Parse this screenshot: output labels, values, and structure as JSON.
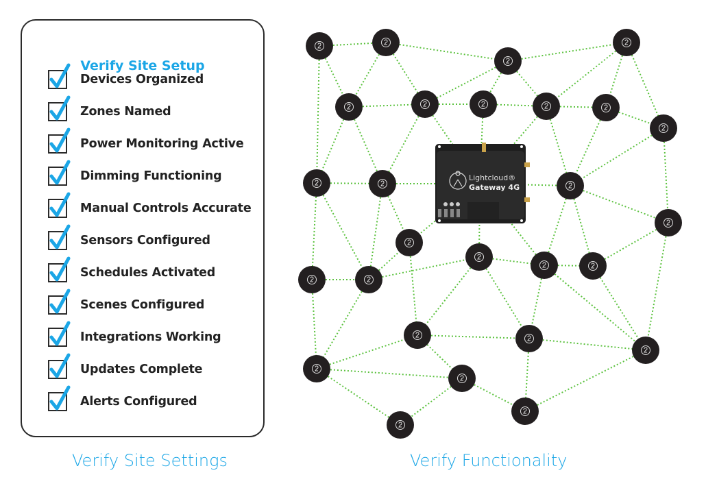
{
  "checklist": {
    "title": "Verify Site Setup",
    "items": [
      {
        "label": "Devices Organized",
        "checked": true
      },
      {
        "label": "Zones Named",
        "checked": true
      },
      {
        "label": "Power Monitoring Active",
        "checked": true
      },
      {
        "label": "Dimming Functioning",
        "checked": true
      },
      {
        "label": "Manual Controls Accurate",
        "checked": true
      },
      {
        "label": "Sensors Configured",
        "checked": true
      },
      {
        "label": "Schedules Activated",
        "checked": true
      },
      {
        "label": "Scenes Configured",
        "checked": true
      },
      {
        "label": "Integrations Working",
        "checked": true
      },
      {
        "label": "Updates Complete",
        "checked": true
      },
      {
        "label": "Alerts Configured",
        "checked": true
      }
    ]
  },
  "captions": {
    "left": "Verify Site Settings",
    "right": "Verify Functionality"
  },
  "gateway": {
    "brand": "Lightcloud®",
    "model": "Gateway 4G"
  },
  "colors": {
    "accent": "#1ba6e6",
    "mesh_link": "#5cc23f",
    "node": "#231f20",
    "gateway": "#2b2b2b"
  }
}
